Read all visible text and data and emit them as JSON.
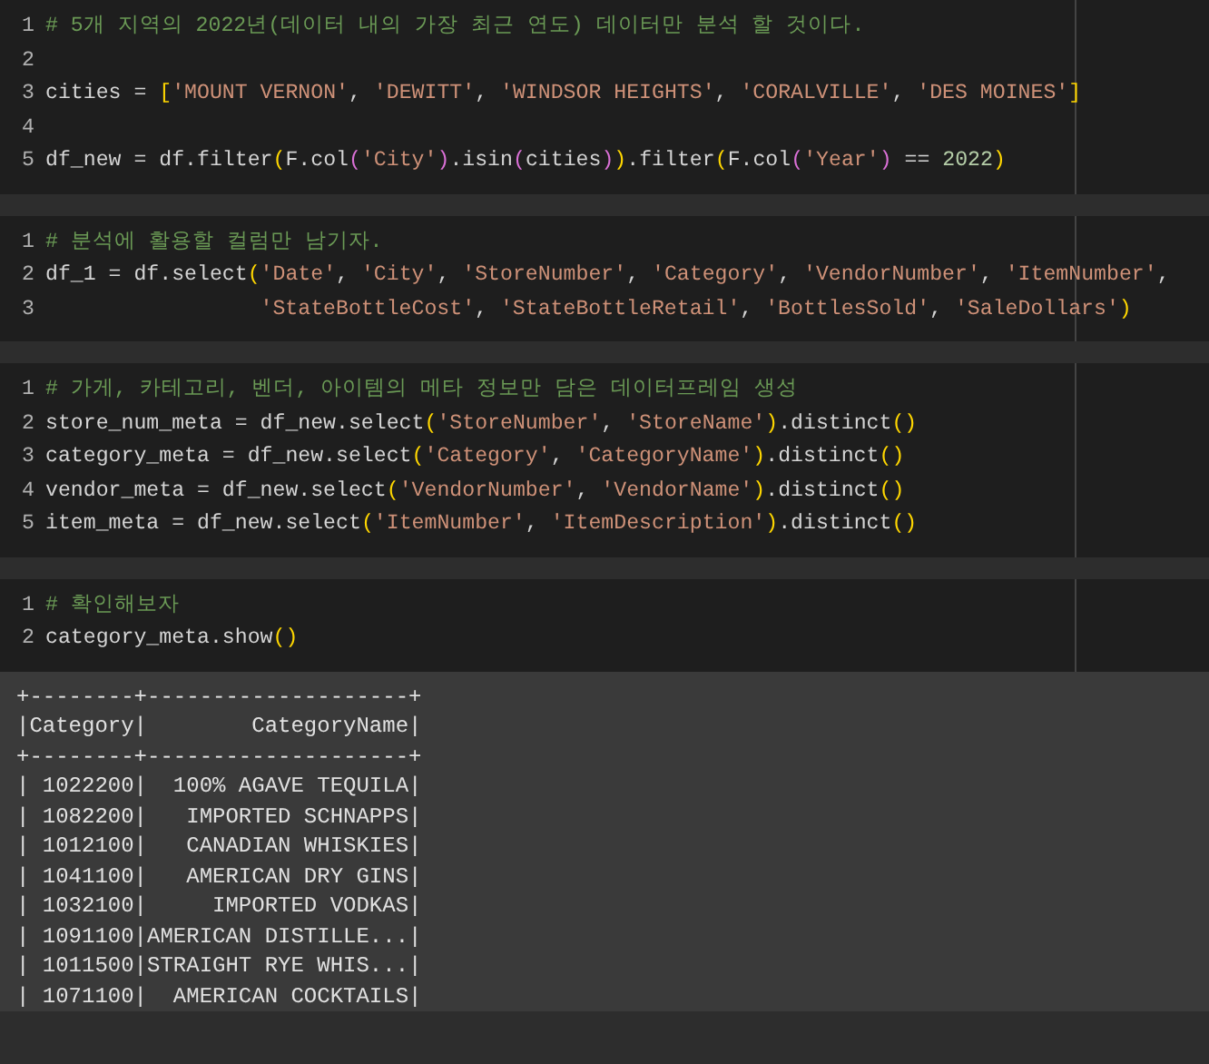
{
  "cells": [
    {
      "lines": [
        {
          "number": "1",
          "tokens": [
            {
              "kind": "comment",
              "text": "# 5개 지역의 2022년(데이터 내의 가장 최근 연도) 데이터만 분석 할 것이다."
            }
          ]
        },
        {
          "number": "2"
        },
        {
          "number": "3",
          "tokens": [
            {
              "kind": "plain",
              "text": "cities = "
            },
            {
              "kind": "bracket1",
              "text": "["
            },
            {
              "kind": "string",
              "text": "'MOUNT VERNON'"
            },
            {
              "kind": "plain",
              "text": ", "
            },
            {
              "kind": "string",
              "text": "'DEWITT'"
            },
            {
              "kind": "plain",
              "text": ", "
            },
            {
              "kind": "string",
              "text": "'WINDSOR HEIGHTS'"
            },
            {
              "kind": "plain",
              "text": ", "
            },
            {
              "kind": "string",
              "text": "'CORALVILLE'"
            },
            {
              "kind": "plain",
              "text": ", "
            },
            {
              "kind": "string",
              "text": "'DES MOINES'"
            },
            {
              "kind": "bracket1",
              "text": "]"
            }
          ]
        },
        {
          "number": "4"
        },
        {
          "number": "5",
          "tokens": [
            {
              "kind": "plain",
              "text": "df_new = df.filter"
            },
            {
              "kind": "bracket1",
              "text": "("
            },
            {
              "kind": "plain",
              "text": "F.col"
            },
            {
              "kind": "bracket2",
              "text": "("
            },
            {
              "kind": "string",
              "text": "'City'"
            },
            {
              "kind": "bracket2",
              "text": ")"
            },
            {
              "kind": "plain",
              "text": ".isin"
            },
            {
              "kind": "bracket2",
              "text": "("
            },
            {
              "kind": "plain",
              "text": "cities"
            },
            {
              "kind": "bracket2",
              "text": ")"
            },
            {
              "kind": "bracket1",
              "text": ")"
            },
            {
              "kind": "plain",
              "text": ".filter"
            },
            {
              "kind": "bracket1",
              "text": "("
            },
            {
              "kind": "plain",
              "text": "F.col"
            },
            {
              "kind": "bracket2",
              "text": "("
            },
            {
              "kind": "string",
              "text": "'Year'"
            },
            {
              "kind": "bracket2",
              "text": ")"
            },
            {
              "kind": "plain",
              "text": " == "
            },
            {
              "kind": "number",
              "text": "2022"
            },
            {
              "kind": "bracket1",
              "text": ")"
            }
          ]
        }
      ]
    },
    {
      "lines": [
        {
          "number": "1",
          "tokens": [
            {
              "kind": "comment",
              "text": "# 분석에 활용할 컬럼만 남기자."
            }
          ]
        },
        {
          "number": "2",
          "tokens": [
            {
              "kind": "plain",
              "text": "df_1 = df.select"
            },
            {
              "kind": "bracket1",
              "text": "("
            },
            {
              "kind": "string",
              "text": "'Date'"
            },
            {
              "kind": "plain",
              "text": ", "
            },
            {
              "kind": "string",
              "text": "'City'"
            },
            {
              "kind": "plain",
              "text": ", "
            },
            {
              "kind": "string",
              "text": "'StoreNumber'"
            },
            {
              "kind": "plain",
              "text": ", "
            },
            {
              "kind": "string",
              "text": "'Category'"
            },
            {
              "kind": "plain",
              "text": ", "
            },
            {
              "kind": "string",
              "text": "'VendorNumber'"
            },
            {
              "kind": "plain",
              "text": ", "
            },
            {
              "kind": "string",
              "text": "'ItemNumber'"
            },
            {
              "kind": "plain",
              "text": ","
            }
          ]
        },
        {
          "number": "3",
          "continuation": true,
          "tokens": [
            {
              "kind": "string",
              "text": "'StateBottleCost'"
            },
            {
              "kind": "plain",
              "text": ", "
            },
            {
              "kind": "string",
              "text": "'StateBottleRetail'"
            },
            {
              "kind": "plain",
              "text": ", "
            },
            {
              "kind": "string",
              "text": "'BottlesSold'"
            },
            {
              "kind": "plain",
              "text": ", "
            },
            {
              "kind": "string",
              "text": "'SaleDollars'"
            },
            {
              "kind": "bracket1",
              "text": ")"
            }
          ]
        }
      ]
    },
    {
      "lines": [
        {
          "number": "1",
          "tokens": [
            {
              "kind": "comment",
              "text": "# 가게, 카테고리, 벤더, 아이템의 메타 정보만 담은 데이터프레임 생성"
            }
          ]
        },
        {
          "number": "2",
          "tokens": [
            {
              "kind": "plain",
              "text": "store_num_meta = df_new.select"
            },
            {
              "kind": "bracket1",
              "text": "("
            },
            {
              "kind": "string",
              "text": "'StoreNumber'"
            },
            {
              "kind": "plain",
              "text": ", "
            },
            {
              "kind": "string",
              "text": "'StoreName'"
            },
            {
              "kind": "bracket1",
              "text": ")"
            },
            {
              "kind": "plain",
              "text": ".distinct"
            },
            {
              "kind": "bracket1",
              "text": "()"
            }
          ]
        },
        {
          "number": "3",
          "tokens": [
            {
              "kind": "plain",
              "text": "category_meta = df_new.select"
            },
            {
              "kind": "bracket1",
              "text": "("
            },
            {
              "kind": "string",
              "text": "'Category'"
            },
            {
              "kind": "plain",
              "text": ", "
            },
            {
              "kind": "string",
              "text": "'CategoryName'"
            },
            {
              "kind": "bracket1",
              "text": ")"
            },
            {
              "kind": "plain",
              "text": ".distinct"
            },
            {
              "kind": "bracket1",
              "text": "()"
            }
          ]
        },
        {
          "number": "4",
          "tokens": [
            {
              "kind": "plain",
              "text": "vendor_meta = df_new.select"
            },
            {
              "kind": "bracket1",
              "text": "("
            },
            {
              "kind": "string",
              "text": "'VendorNumber'"
            },
            {
              "kind": "plain",
              "text": ", "
            },
            {
              "kind": "string",
              "text": "'VendorName'"
            },
            {
              "kind": "bracket1",
              "text": ")"
            },
            {
              "kind": "plain",
              "text": ".distinct"
            },
            {
              "kind": "bracket1",
              "text": "()"
            }
          ]
        },
        {
          "number": "5",
          "tokens": [
            {
              "kind": "plain",
              "text": "item_meta = df_new.select"
            },
            {
              "kind": "bracket1",
              "text": "("
            },
            {
              "kind": "string",
              "text": "'ItemNumber'"
            },
            {
              "kind": "plain",
              "text": ", "
            },
            {
              "kind": "string",
              "text": "'ItemDescription'"
            },
            {
              "kind": "bracket1",
              "text": ")"
            },
            {
              "kind": "plain",
              "text": ".distinct"
            },
            {
              "kind": "bracket1",
              "text": "()"
            }
          ]
        }
      ]
    },
    {
      "lines": [
        {
          "number": "1",
          "tokens": [
            {
              "kind": "comment",
              "text": "# 확인해보자"
            }
          ]
        },
        {
          "number": "2",
          "tokens": [
            {
              "kind": "plain",
              "text": "category_meta.show"
            },
            {
              "kind": "bracket1",
              "text": "()"
            }
          ]
        }
      ],
      "output": [
        "+--------+--------------------+",
        "|Category|        CategoryName|",
        "+--------+--------------------+",
        "| 1022200|  100% AGAVE TEQUILA|",
        "| 1082200|   IMPORTED SCHNAPPS|",
        "| 1012100|   CANADIAN WHISKIES|",
        "| 1041100|   AMERICAN DRY GINS|",
        "| 1032100|     IMPORTED VODKAS|",
        "| 1091100|AMERICAN DISTILLE...|",
        "| 1011500|STRAIGHT RYE WHIS...|",
        "| 1071100|  AMERICAN COCKTAILS|"
      ]
    }
  ]
}
